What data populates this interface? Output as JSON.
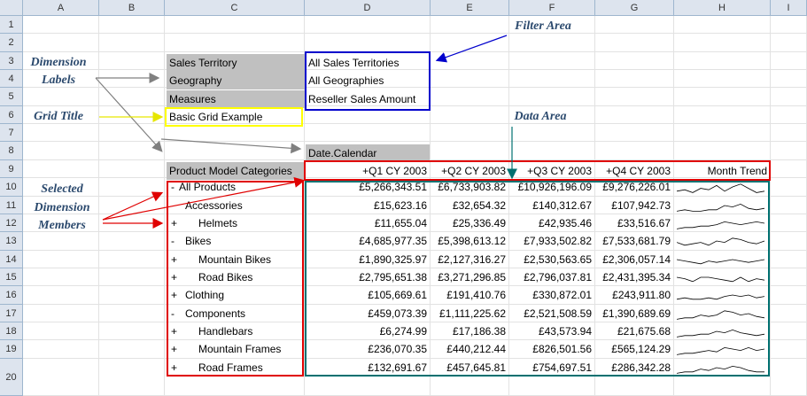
{
  "columns": [
    "A",
    "B",
    "C",
    "D",
    "E",
    "F",
    "G",
    "H",
    "I"
  ],
  "rows": [
    "1",
    "2",
    "3",
    "4",
    "5",
    "6",
    "7",
    "8",
    "9",
    "10",
    "11",
    "12",
    "13",
    "14",
    "15",
    "16",
    "17",
    "18",
    "19",
    "20"
  ],
  "dimension_labels": [
    "Sales Territory",
    "Geography",
    "Measures"
  ],
  "filters": [
    "All Sales Territories",
    "All Geographies",
    "Reseller Sales Amount"
  ],
  "grid_title": "Basic Grid Example",
  "column_dimension": "Date.Calendar",
  "row_dimension_header": "Product Model Categories",
  "column_headers": [
    "+Q1 CY 2003",
    "+Q2 CY 2003",
    "+Q3 CY 2003",
    "+Q4 CY 2003",
    "Month Trend"
  ],
  "members": [
    {
      "expander": "-",
      "label": "All Products",
      "indent": 0
    },
    {
      "expander": "",
      "label": "Accessories",
      "indent": 1
    },
    {
      "expander": "+",
      "label": "Helmets",
      "indent": 2
    },
    {
      "expander": "-",
      "label": "Bikes",
      "indent": 1
    },
    {
      "expander": "+",
      "label": "Mountain Bikes",
      "indent": 2
    },
    {
      "expander": "+",
      "label": "Road Bikes",
      "indent": 2
    },
    {
      "expander": "+",
      "label": "Clothing",
      "indent": 1
    },
    {
      "expander": "-",
      "label": "Components",
      "indent": 1
    },
    {
      "expander": "+",
      "label": "Handlebars",
      "indent": 2
    },
    {
      "expander": "+",
      "label": "Mountain Frames",
      "indent": 2
    },
    {
      "expander": "+",
      "label": "Road Frames",
      "indent": 2
    }
  ],
  "values": [
    [
      "£5,266,343.51",
      "£6,733,903.82",
      "£10,926,196.09",
      "£9,276,226.01"
    ],
    [
      "£15,623.16",
      "£32,654.32",
      "£140,312.67",
      "£107,942.73"
    ],
    [
      "£11,655.04",
      "£25,336.49",
      "£42,935.46",
      "£33,516.67"
    ],
    [
      "£4,685,977.35",
      "£5,398,613.12",
      "£7,933,502.82",
      "£7,533,681.79"
    ],
    [
      "£1,890,325.97",
      "£2,127,316.27",
      "£2,530,563.65",
      "£2,306,057.14"
    ],
    [
      "£2,795,651.38",
      "£3,271,296.85",
      "£2,796,037.81",
      "£2,431,395.34"
    ],
    [
      "£105,669.61",
      "£191,410.76",
      "£330,872.01",
      "£243,911.80"
    ],
    [
      "£459,073.39",
      "£1,111,225.62",
      "£2,521,508.59",
      "£1,390,689.69"
    ],
    [
      "£6,274.99",
      "£17,186.38",
      "£43,573.94",
      "£21,675.68"
    ],
    [
      "£236,070.35",
      "£440,212.44",
      "£826,501.56",
      "£565,124.29"
    ],
    [
      "£132,691.67",
      "£457,645.81",
      "£754,697.51",
      "£286,342.28"
    ]
  ],
  "callouts": {
    "filter_area": "Filter Area",
    "dimension_labels": [
      "Dimension",
      "Labels"
    ],
    "grid_title": "Grid Title",
    "data_area": "Data Area",
    "selected_members": [
      "Selected",
      "Dimension",
      "Members"
    ]
  },
  "colors": {
    "blue": "#0000cc",
    "yellow": "#ffff00",
    "red": "#e00000",
    "teal": "#007070",
    "gray": "#c0c0c0"
  }
}
